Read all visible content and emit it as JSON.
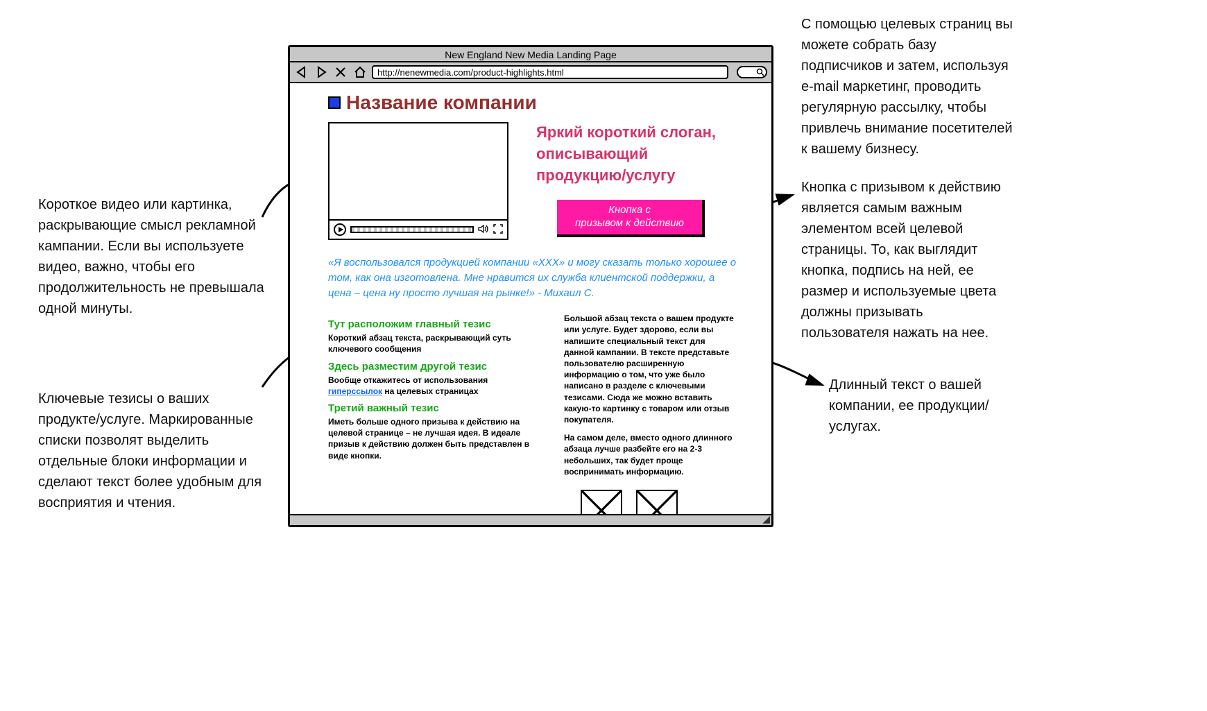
{
  "browser": {
    "title": "New England New Media Landing Page",
    "url": "http://nenewmedia.com/product-highlights.html"
  },
  "header": {
    "company_name": "Название компании"
  },
  "hero": {
    "slogan": "Яркий короткий слоган, описывающий продукцию/услугу",
    "cta_line1": "Кнопка с",
    "cta_line2": "призывом к действию"
  },
  "quote": "«Я воспользовался продукцией компании «XXX» и могу сказать только хорошее о том, как она изготовлена. Мне нравится их служба клиентской поддержки, а цена – цена ну просто лучшая на рынке!» - Михаил С.",
  "theses": [
    {
      "title": "Тут расположим главный тезис",
      "body": "Короткий абзац текста, раскрывающий суть ключевого сообщения"
    },
    {
      "title": "Здесь разместим другой тезис",
      "body_pre": "Вообще откажитесь от использования ",
      "link": "гиперссылок",
      "body_post": " на целевых страницах"
    },
    {
      "title": "Третий важный тезис",
      "body": "Иметь больше одного призыва к действию на целевой странице – не лучшая идея. В идеале призыв к действию должен быть представлен в виде кнопки."
    }
  ],
  "right_paras": [
    "Большой абзац текста о вашем продукте или услуге. Будет здорово, если вы напишите специальный текст для данной кампании. В тексте представьте пользователю расширенную информацию о том, что уже было написано в разделе с ключевыми тезисами. Сюда же можно вставить какую-то картинку с товаром или отзыв покупателя.",
    "На самом деле, вместо одного длинного абзаца лучше разбейте его на 2-3 небольших, так будет проще воспринимать информацию."
  ],
  "annotations": {
    "top_right": "С помощью целевых страниц вы можете собрать базу подписчиков и затем, используя e-mail маркетинг, проводить регулярную рассылку, чтобы привлечь внимание посетителей к вашему бизнесу.",
    "left_video": "Короткое видео или картинка, раскрывающие смысл рекламной кампании. Если вы используете видео, важно, чтобы его продолжительность не превышала одной минуты.",
    "right_cta": "Кнопка с призывом к действию является самым важным элементом всей целевой страницы. То, как выглядит кнопка, подпись на ней, ее размер и используемые цвета должны призывать пользователя нажать на нее.",
    "left_theses": "Ключевые тезисы о ваших продукте/услуге. Маркированные списки позволят выделить отдельные блоки информации и сделают текст более удобным для восприятия и чтения.",
    "right_text": "Длинный текст о вашей компании, ее продукции/ услугах."
  }
}
